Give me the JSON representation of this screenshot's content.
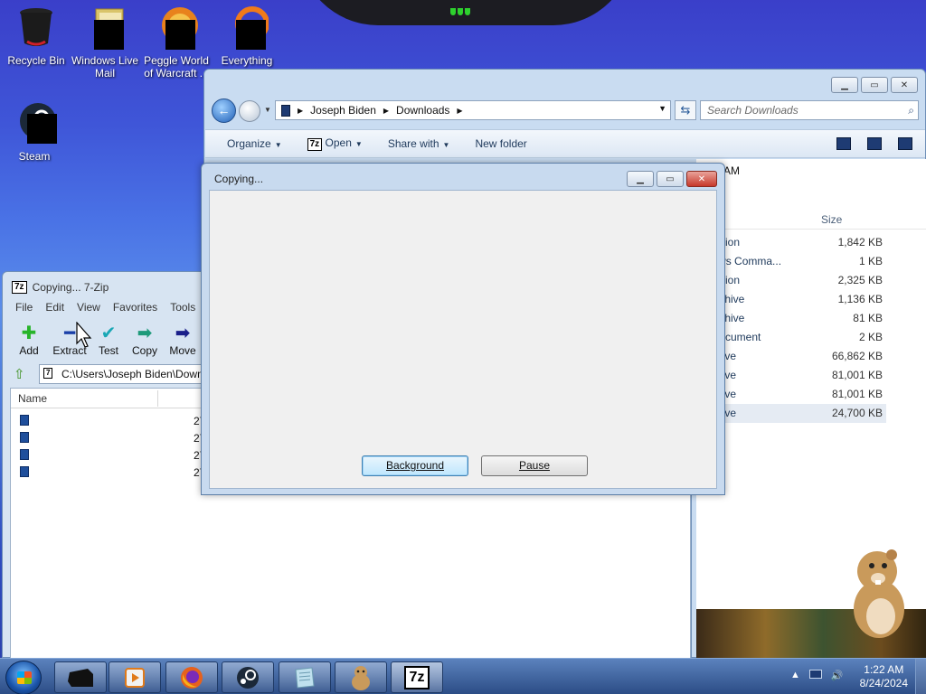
{
  "desktop": {
    "icons": [
      {
        "label": "Recycle Bin",
        "icon": "recycle-bin-icon"
      },
      {
        "label": "Windows Live Mail",
        "icon": "windows-live-mail-icon"
      },
      {
        "label": "Peggle World of Warcraft ...",
        "icon": "peggle-icon"
      },
      {
        "label": "Everything",
        "icon": "everything-icon"
      },
      {
        "label": "Steam",
        "icon": "steam-icon"
      }
    ]
  },
  "explorer": {
    "breadcrumb": [
      "Joseph Biden",
      "Downloads"
    ],
    "search_placeholder": "Search Downloads",
    "commands": [
      "Organize",
      "Open",
      "Share with",
      "New folder"
    ],
    "time_text": "1:19 AM",
    "columns": {
      "type": "pe",
      "size": "Size"
    },
    "rows": [
      {
        "type": "plication",
        "size": "1,842 KB"
      },
      {
        "type": "ndows Comma...",
        "size": "1 KB"
      },
      {
        "type": "plication",
        "size": "2,325 KB"
      },
      {
        "type": "p Archive",
        "size": "1,136 KB"
      },
      {
        "type": "p Archive",
        "size": "81 KB"
      },
      {
        "type": "xt Document",
        "size": "2 KB"
      },
      {
        "type": "Archive",
        "size": "66,862 KB"
      },
      {
        "type": "Archive",
        "size": "81,001 KB"
      },
      {
        "type": "Archive",
        "size": "81,001 KB"
      },
      {
        "type": "Archive",
        "size": "24,700 KB"
      }
    ]
  },
  "zip": {
    "title": "Copying... 7-Zip",
    "menu": [
      "File",
      "Edit",
      "View",
      "Favorites",
      "Tools"
    ],
    "tools": [
      {
        "label": "Add",
        "glyph": "✚",
        "color": "#27b42a"
      },
      {
        "label": "Extract",
        "glyph": "━",
        "color": "#1a3fa8"
      },
      {
        "label": "Test",
        "glyph": "✔",
        "color": "#1aa7b5"
      },
      {
        "label": "Copy",
        "glyph": "➡",
        "color": "#1e9a7a"
      },
      {
        "label": "Move",
        "glyph": "➡",
        "color": "#1a1f8a"
      }
    ],
    "path": "C:\\Users\\Joseph Biden\\Downl",
    "column_name": "Name",
    "rows": [
      "27",
      "27",
      "27",
      "27"
    ]
  },
  "dialog": {
    "title": "Copying...",
    "background_label": "Background",
    "pause_label": "Pause"
  },
  "taskbar": {
    "clock_time": "1:22 AM",
    "clock_date": "8/24/2024",
    "items": [
      "black-app",
      "media-player",
      "firefox",
      "steam",
      "notepad",
      "hamster",
      "7-zip"
    ]
  }
}
